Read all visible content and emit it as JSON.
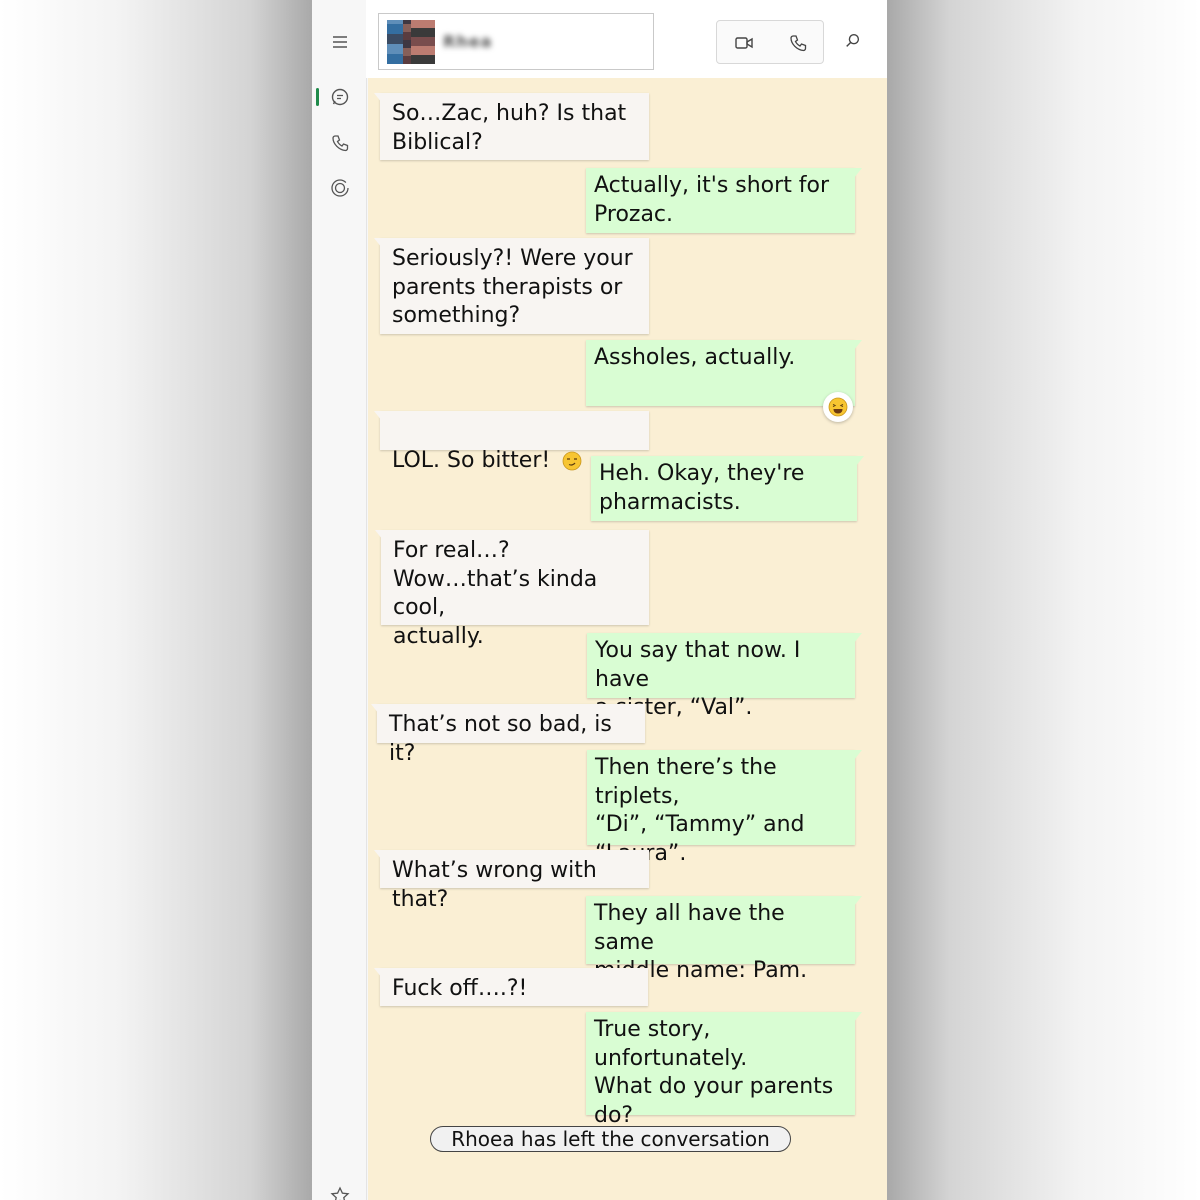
{
  "contact": {
    "name": "Rhea",
    "avatar_icon": "avatar-photo"
  },
  "header": {
    "video_icon": "video-camera-icon",
    "call_icon": "phone-icon",
    "search_icon": "search-icon"
  },
  "sidebar": {
    "items": [
      {
        "name": "menu",
        "icon": "hamburger-icon"
      },
      {
        "name": "chats",
        "icon": "chat-icon",
        "active": true
      },
      {
        "name": "calls",
        "icon": "phone-icon"
      },
      {
        "name": "status",
        "icon": "status-icon"
      },
      {
        "name": "starred",
        "icon": "star-icon"
      }
    ]
  },
  "messages": [
    {
      "from": "them",
      "text": "So…Zac, huh?  Is that\nBiblical?"
    },
    {
      "from": "me",
      "text": "Actually, it's short for\nProzac."
    },
    {
      "from": "them",
      "text": "Seriously?!  Were your\nparents therapists or\nsomething?"
    },
    {
      "from": "me",
      "text": "Assholes, actually.",
      "reaction": "😆"
    },
    {
      "from": "them",
      "text": "LOL.  So bitter!",
      "emoji": "😏"
    },
    {
      "from": "me",
      "text": "Heh.  Okay, they're\npharmacists."
    },
    {
      "from": "them",
      "text": "For real…?\nWow…that’s kinda cool,\nactually."
    },
    {
      "from": "me",
      "text": "You say that now.  I have\na sister, “Val”."
    },
    {
      "from": "them",
      "text": "That’s not so bad, is it?"
    },
    {
      "from": "me",
      "text": "Then there’s the triplets,\n“Di”, “Tammy” and\n“Laura”."
    },
    {
      "from": "them",
      "text": "What’s wrong with that?"
    },
    {
      "from": "me",
      "text": "They all have the same\nmiddle name:  Pam."
    },
    {
      "from": "them",
      "text": "Fuck off….?!"
    },
    {
      "from": "me",
      "text": "True story, unfortunately.\nWhat do your parents\ndo?"
    }
  ],
  "system_message": "Rhoea has left the conversation",
  "colors": {
    "chat_bg": "#faefd4",
    "incoming_bubble": "#f8f5f2",
    "outgoing_bubble": "#d9fdd3",
    "active_indicator": "#1f8a4a"
  }
}
